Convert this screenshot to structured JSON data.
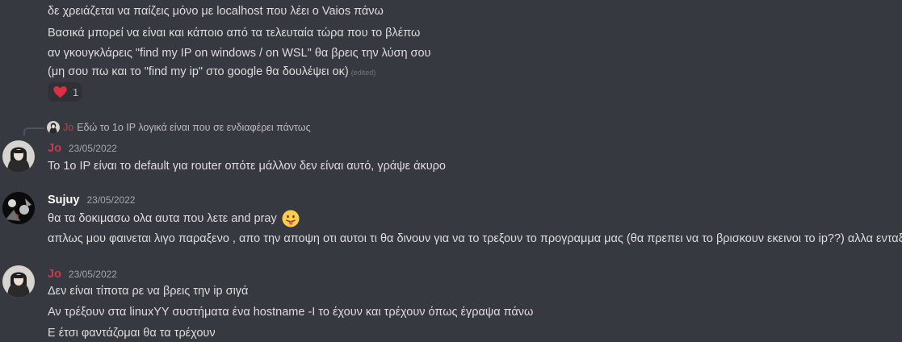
{
  "messages": {
    "top": {
      "lines": [
        "δε χρειάζεται να παίζεις μόνο με localhost που λέει ο Vaios πάνω",
        "Βασικά μπορεί να είναι και κάποιο από τα τελευταία τώρα που το βλέπω",
        "αν γκουγκλάρεις \"find my IP on windows / on WSL\" θα βρεις την λύση σου",
        "(μη σου πω και το \"find my ip\" στο google θα δουλέψει οκ)"
      ],
      "edited": "(edited)",
      "reaction": {
        "emoji": "heart-icon",
        "count": "1"
      }
    },
    "jo1": {
      "reply_author": "Jo",
      "reply_text": "Εδώ το 1ο IP λογικά είναι που σε ενδιαφέρει πάντως",
      "author": "Jo",
      "timestamp": "23/05/2022",
      "lines": [
        "Το 1ο IP είναι το default για router οπότε μάλλον δεν είναι αυτό, γράψε άκυρο"
      ]
    },
    "sujuy": {
      "author": "Sujuy",
      "timestamp": "23/05/2022",
      "lines": [
        "θα τα δοκιμασω ολα αυτα που λετε  and pray",
        "απλως μου φαινεται λιγο παραξενο , απο την αποψη οτι αυτοι τι θα δινουν για να το τρεξουν το προγραμμα μας (θα πρεπει να το βρισκουν εκεινοι το ip??) αλλα ενταξει"
      ]
    },
    "jo2": {
      "author": "Jo",
      "timestamp": "23/05/2022",
      "lines": [
        "Δεν είναι τίποτα ρε να βρεις την ip σιγά",
        "Αν τρέξουν στα linuxYY συστήματα ένα hostname -I το έχουν και τρέχουν όπως έγραψα πάνω",
        "Ε έτσι φαντάζομαι θα τα τρέχουν"
      ]
    }
  },
  "colors": {
    "background": "#36393f",
    "jo_name": "#c9394f",
    "sujuy_name": "#ffffff",
    "text": "#dcddde",
    "timestamp": "#a3a6aa"
  }
}
